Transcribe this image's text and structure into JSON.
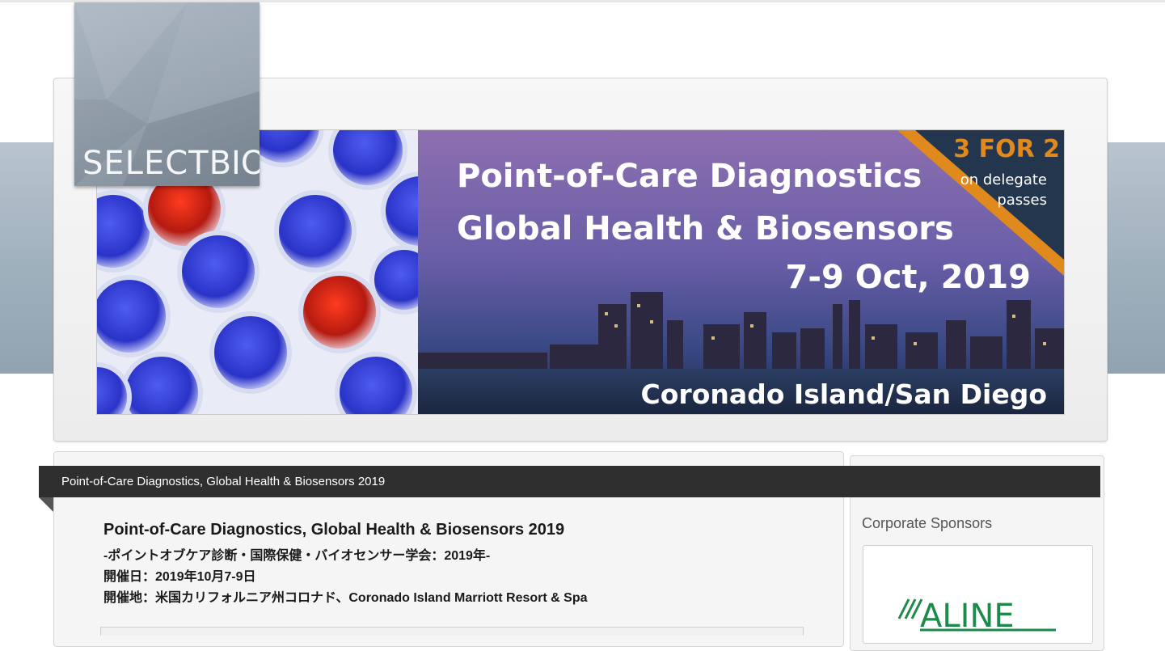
{
  "logo": {
    "text_light": "SELECT",
    "text_bold": "BIO"
  },
  "banner": {
    "promo_big": "3 FOR 2",
    "promo_line1": "on delegate",
    "promo_line2": "passes",
    "headline1": "Point-of-Care Diagnostics",
    "headline2": "Global Health & Biosensors",
    "dates": "7-9 Oct, 2019",
    "location": "Coronado Island/San Diego"
  },
  "page_header": {
    "title": "Point-of-Care Diagnostics, Global Health & Biosensors 2019"
  },
  "content": {
    "title": "Point-of-Care Diagnostics, Global Health & Biosensors 2019",
    "subtitle": "-ポイントオブケア診断・国際保健・バイオセンサー学会：2019年-",
    "date_line": "開催日：2019年10月7-9日",
    "venue_line": "開催地：米国カリフォルニア州コロナド、Coronado Island Marriott Resort & Spa"
  },
  "sidebar": {
    "title": "Corporate Sponsors",
    "sponsor_logo_text": "ALINE"
  },
  "colors": {
    "title_bar_bg": "#2f2f2f",
    "promo_orange": "#e08a1e",
    "aline_green": "#1c8a4a"
  }
}
